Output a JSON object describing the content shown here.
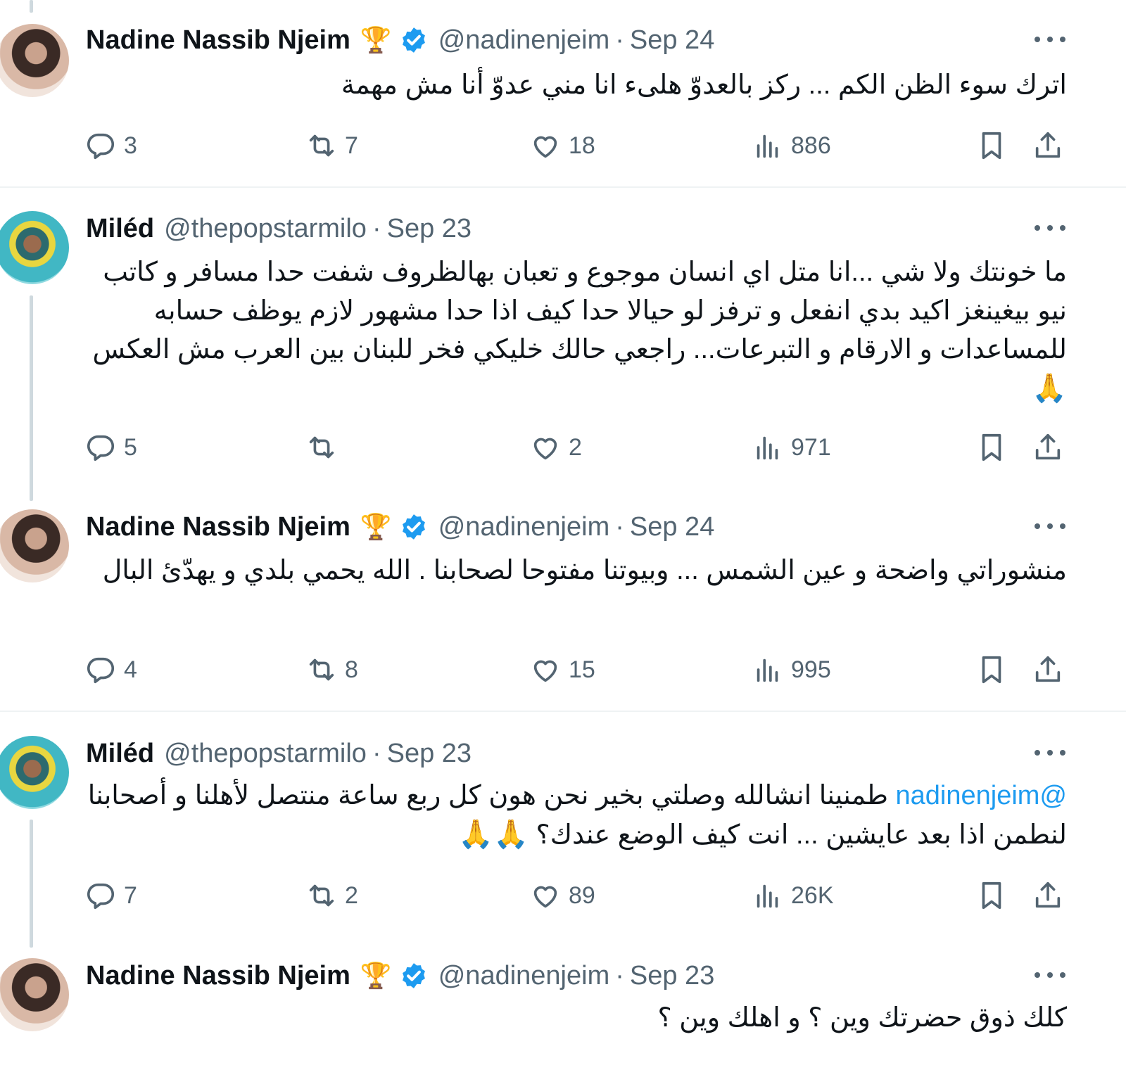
{
  "tweets": [
    {
      "name": "Nadine Nassib Njeim",
      "trophy": "🏆",
      "handle": "@nadinenjeim",
      "sep": "·",
      "date": "Sep 24",
      "text": "اترك سوء الظن الكم ... ركز بالعدوّ هلىء  انا مني عدوّ أنا مش مهمة",
      "replies": "3",
      "retweets": "7",
      "likes": "18",
      "views": "886"
    },
    {
      "name": "Miléd",
      "handle": "@thepopstarmilo",
      "sep": "·",
      "date": "Sep 23",
      "text": "ما خونتك ولا شي ...انا متل اي انسان موجوع و تعبان بهالظروف شفت حدا مسافر و كاتب نيو بيغينغز اكيد بدي انفعل و ترفز لو حيالا حدا كيف اذا حدا مشهور لازم يوظف حسابه للمساعدات و الارقام و التبرعات... راجعي حالك خليكي فخر للبنان بين العرب مش العكس",
      "emoji": "🙏",
      "replies": "5",
      "retweets": "",
      "likes": "2",
      "views": "971"
    },
    {
      "name": "Nadine Nassib Njeim",
      "trophy": "🏆",
      "handle": "@nadinenjeim",
      "sep": "·",
      "date": "Sep 24",
      "text": "منشوراتي واضحة و عين الشمس ... وبيوتنا مفتوحا لصحابنا . الله يحمي بلدي و يهدّئ البال",
      "replies": "4",
      "retweets": "8",
      "likes": "15",
      "views": "995"
    },
    {
      "name": "Miléd",
      "handle": "@thepopstarmilo",
      "sep": "·",
      "date": "Sep 23",
      "mention": "@nadinenjeim",
      "text": " طمنينا انشالله وصلتي بخير نحن هون كل ربع ساعة منتصل لأهلنا و أصحابنا لنطمن اذا بعد عايشين ... انت كيف الوضع عندك؟ ",
      "emoji": "🙏🙏",
      "replies": "7",
      "retweets": "2",
      "likes": "89",
      "views": "26K"
    },
    {
      "name": "Nadine Nassib Njeim",
      "trophy": "🏆",
      "handle": "@nadinenjeim",
      "sep": "·",
      "date": "Sep 23",
      "text": "كلك ذوق حضرتك وين ؟ و اهلك وين ؟"
    }
  ],
  "icons": {
    "reply": "reply-icon",
    "retweet": "retweet-icon",
    "like": "heart-icon",
    "views": "views-icon",
    "bookmark": "bookmark-icon",
    "share": "share-icon",
    "verified": "verified-badge-icon",
    "more": "more-icon"
  },
  "colors": {
    "accent": "#1d9bf0",
    "secondary_text": "#536471",
    "thread_line": "#cfd9de"
  }
}
